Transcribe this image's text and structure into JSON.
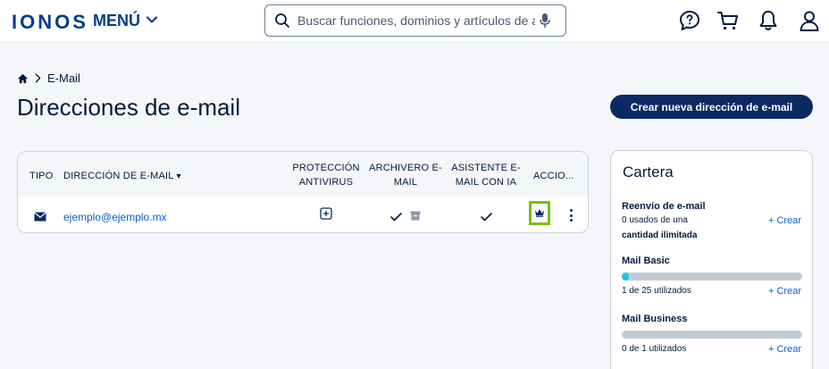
{
  "header": {
    "logo": "IONOS",
    "menu_label": "MENÚ",
    "search_placeholder": "Buscar funciones, dominios y artículos de a...",
    "icons": [
      "help-icon",
      "cart-icon",
      "bell-icon",
      "user-icon"
    ]
  },
  "breadcrumb": {
    "home_icon": "home-icon",
    "current": "E-Mail"
  },
  "page": {
    "title": "Direcciones de e-mail",
    "create_button": "Crear nueva dirección de e-mail"
  },
  "table": {
    "headers": {
      "tipo": "TIPO",
      "direccion": "DIRECCIÓN DE E-MAIL",
      "sort_indicator": "▾",
      "proteccion_1": "PROTECCIÓN",
      "proteccion_2": "ANTIVIRUS",
      "archivero_1": "ARCHIVERO E-",
      "archivero_2": "MAIL",
      "asistente_1": "ASISTENTE E-",
      "asistente_2": "MAIL CON IA",
      "acciones": "ACCIO..."
    },
    "rows": [
      {
        "type_icon": "envelope-icon",
        "email": "ejemplo@ejemplo.mx",
        "antivirus_icon": "add-square-icon",
        "archive_icons": [
          "check-icon",
          "archive-box-icon"
        ],
        "assistant_icon": "check-icon",
        "action_icons": [
          "crown-icon",
          "more-vertical-icon"
        ]
      }
    ]
  },
  "cartera": {
    "title": "Cartera",
    "items": [
      {
        "name": "Reenvío de e-mail",
        "line1": "0 usados de una",
        "line2": "cantidad ilimitada",
        "create": "+ Crear"
      },
      {
        "name": "Mail Basic",
        "usage": "1 de 25 utilizados",
        "used": 1,
        "total": 25,
        "create": "+ Crear"
      },
      {
        "name": "Mail Business",
        "usage": "0 de 1 utilizados",
        "used": 0,
        "total": 1,
        "create": "+ Crear"
      }
    ]
  },
  "colors": {
    "brand": "#003d8f",
    "primary_button": "#0b2a63",
    "link": "#0b5bd3",
    "highlight_border": "#75c111",
    "bar_fill": "#11c7e6",
    "bar_track": "#c3ccd6"
  }
}
